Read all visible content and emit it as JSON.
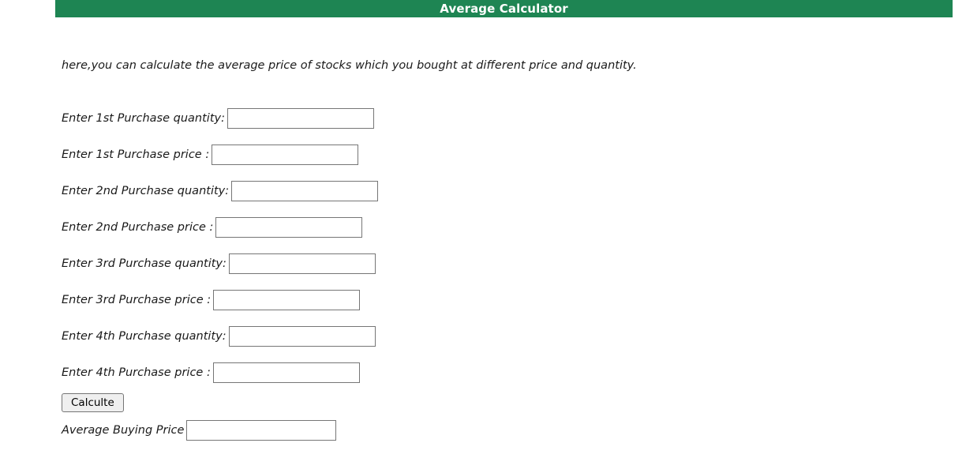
{
  "header": {
    "title": "Average Calculator",
    "background_color": "#1e8553",
    "text_color": "#ffffff"
  },
  "intro": {
    "text": "here,you can calculate the average price of stocks which you bought at different price and quantity."
  },
  "form": {
    "fields": [
      {
        "label": "Enter 1st Purchase quantity:",
        "value": "",
        "placeholder": ""
      },
      {
        "label": "Enter 1st Purchase price :",
        "value": "",
        "placeholder": ""
      },
      {
        "label": "Enter 2nd Purchase quantity:",
        "value": "",
        "placeholder": ""
      },
      {
        "label": "Enter 2nd Purchase price :",
        "value": "",
        "placeholder": ""
      },
      {
        "label": "Enter 3rd Purchase quantity:",
        "value": "",
        "placeholder": ""
      },
      {
        "label": "Enter 3rd Purchase price :",
        "value": "",
        "placeholder": ""
      },
      {
        "label": "Enter 4th Purchase quantity:",
        "value": "",
        "placeholder": ""
      },
      {
        "label": "Enter 4th Purchase price :",
        "value": "",
        "placeholder": ""
      }
    ],
    "submit_label": "Calculte",
    "result": {
      "label": "Average Buying Price",
      "value": "",
      "placeholder": ""
    }
  }
}
